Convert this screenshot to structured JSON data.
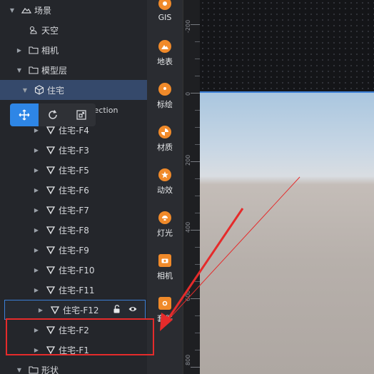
{
  "tree": {
    "root_label": "场景",
    "sky_label": "天空",
    "camera_label": "相机",
    "model_layer_label": "模型层",
    "selected_label": "住宅",
    "collection_label": "Scene Collection",
    "children": [
      "住宅-F4",
      "住宅-F3",
      "住宅-F5",
      "住宅-F6",
      "住宅-F7",
      "住宅-F8",
      "住宅-F9",
      "住宅-F10",
      "住宅-F11",
      "住宅-F12",
      "住宅-F2",
      "住宅-F1"
    ],
    "shape_label": "形状"
  },
  "tools": [
    {
      "label": "GIS",
      "icon": "gis-icon"
    },
    {
      "label": "地表",
      "icon": "terrain-icon"
    },
    {
      "label": "标绘",
      "icon": "marker-icon"
    },
    {
      "label": "材质",
      "icon": "material-icon"
    },
    {
      "label": "动效",
      "icon": "effect-icon"
    },
    {
      "label": "灯光",
      "icon": "light-icon"
    },
    {
      "label": "相机",
      "icon": "camera-icon"
    },
    {
      "label": "套件",
      "icon": "kit-icon"
    }
  ],
  "ruler": {
    "labels": [
      "-200",
      "0",
      "200",
      "400",
      "600",
      "800"
    ]
  },
  "colors": {
    "accent": "#2e86e6",
    "selection": "#35496b",
    "annotation": "#e52b2b",
    "tool_icon": "#f08a2a"
  }
}
